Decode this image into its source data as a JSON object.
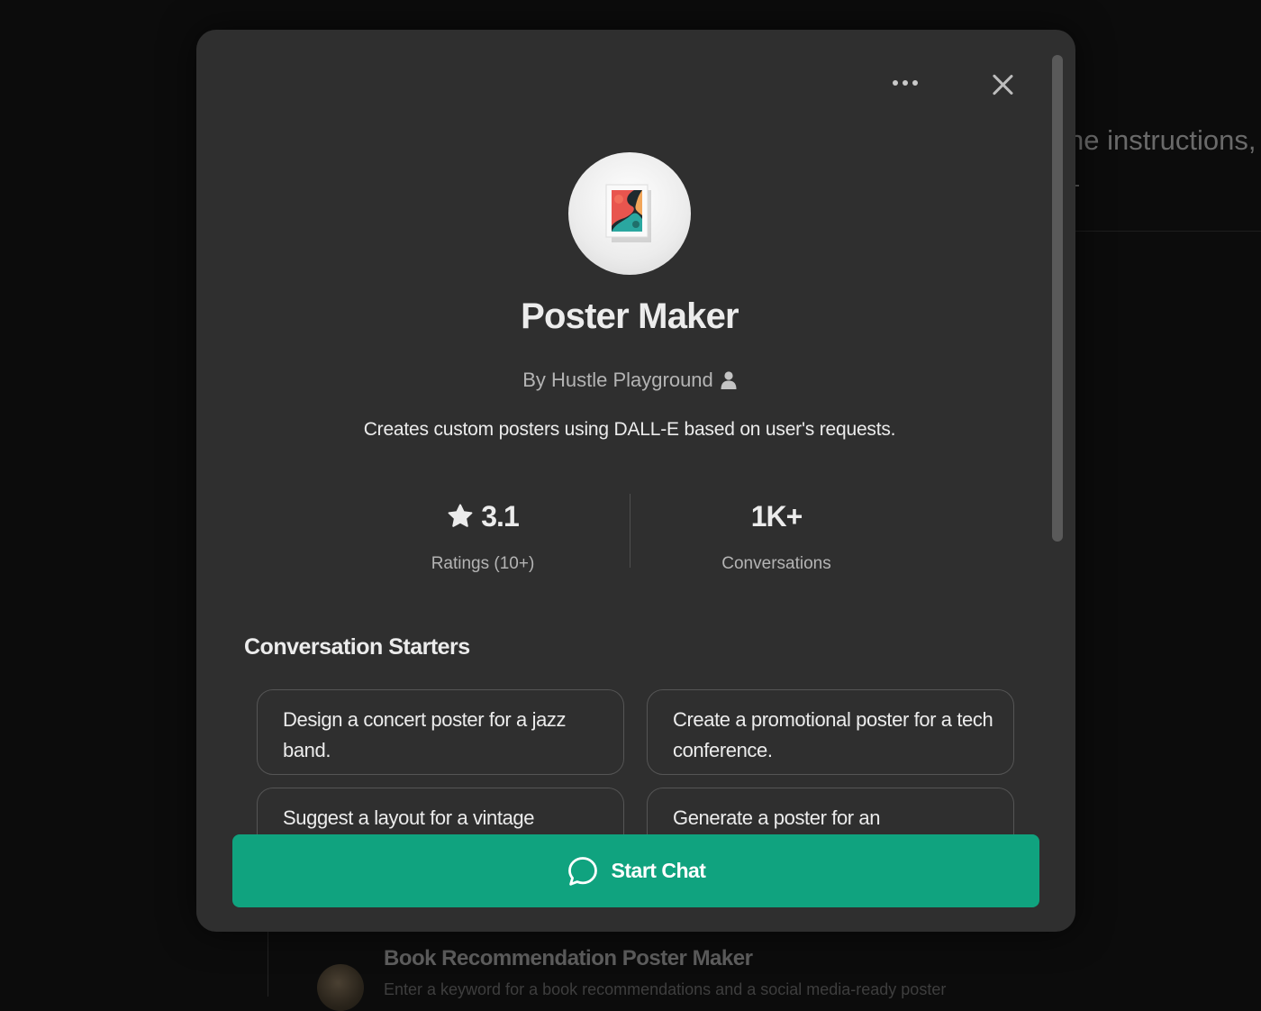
{
  "background": {
    "snippet_text": "he instructions,",
    "list_item": {
      "title": "Book Recommendation Poster Maker",
      "description": "Enter a keyword for a book recommendations and a social media-ready poster"
    }
  },
  "modal": {
    "title": "Poster Maker",
    "author": "By Hustle Playground",
    "description": "Creates custom posters using DALL-E based on user's requests.",
    "stats": {
      "rating_value": "3.1",
      "rating_label": "Ratings (10+)",
      "conversations_value": "1K+",
      "conversations_label": "Conversations"
    },
    "starters_title": "Conversation Starters",
    "starters": [
      "Design a concert poster for a jazz band.",
      "Create a promotional poster for a tech conference.",
      "Suggest a layout for a vintage",
      "Generate a poster for an"
    ],
    "start_chat_label": "Start Chat"
  },
  "icons": {
    "more": "more-horizontal-icon",
    "close": "close-icon",
    "avatar": "poster-avatar-icon",
    "author": "user-icon",
    "rating": "star-icon",
    "chat": "chat-bubble-icon"
  },
  "colors": {
    "modal_bg": "#2f2f2f",
    "accent": "#10a37f",
    "text_primary": "#ececec",
    "text_secondary": "#b4b4b4"
  }
}
